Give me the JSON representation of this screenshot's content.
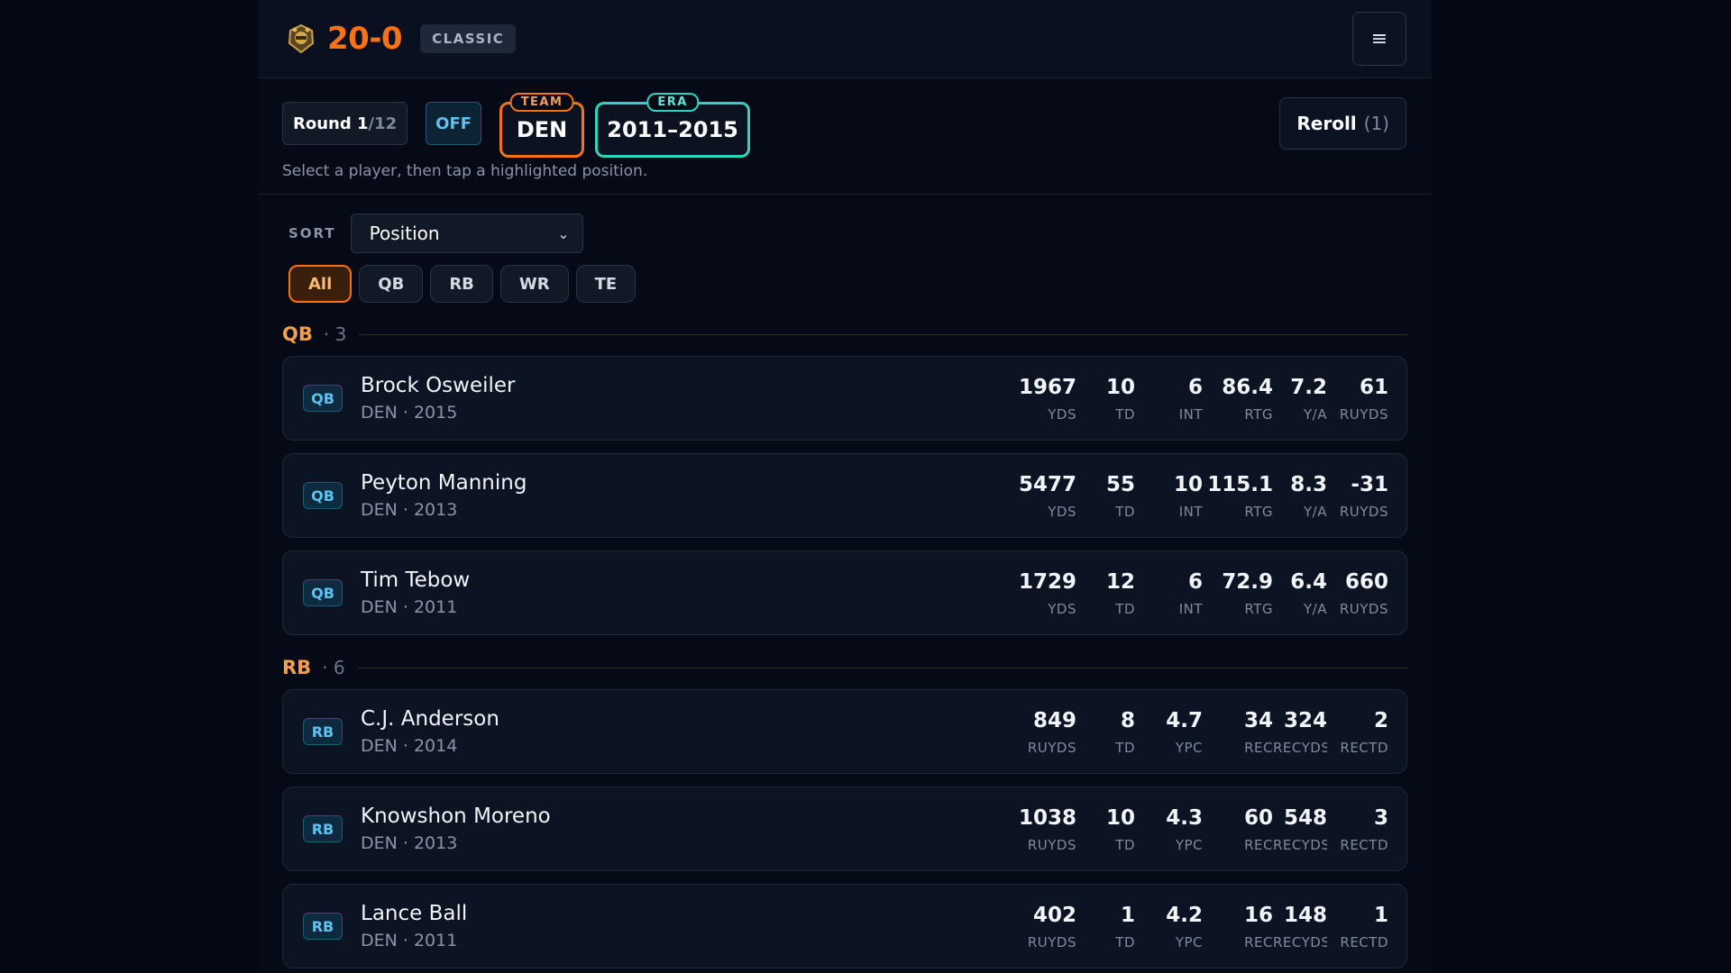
{
  "header": {
    "score": "20-0",
    "mode": "CLASSIC",
    "logo_icon": "trophy-icon",
    "menu_icon": "hamburger-icon"
  },
  "round": {
    "label": "Round 1",
    "total": "/12",
    "side": "OFF",
    "team_label": "TEAM",
    "team": "DEN",
    "era_label": "ERA",
    "era": "2011–2015",
    "reroll_label": "Reroll",
    "reroll_count": "(1)",
    "hint": "Select a player, then tap a highlighted position."
  },
  "controls": {
    "sort_label": "SORT",
    "sort_value": "Position",
    "filters": [
      "All",
      "QB",
      "RB",
      "WR",
      "TE"
    ],
    "active_filter": "All"
  },
  "sections": [
    {
      "pos": "QB",
      "count": "· 3",
      "players": [
        {
          "badge": "QB",
          "name": "Brock Osweiler",
          "sub": "DEN · 2015",
          "stats": [
            [
              "1967",
              "YDS"
            ],
            [
              "10",
              "TD"
            ],
            [
              "6",
              "INT"
            ],
            [
              "86.4",
              "RTG"
            ],
            [
              "7.2",
              "Y/A"
            ],
            [
              "61",
              "RUYDS"
            ]
          ]
        },
        {
          "badge": "QB",
          "name": "Peyton Manning",
          "sub": "DEN · 2013",
          "stats": [
            [
              "5477",
              "YDS"
            ],
            [
              "55",
              "TD"
            ],
            [
              "10",
              "INT"
            ],
            [
              "115.1",
              "RTG"
            ],
            [
              "8.3",
              "Y/A"
            ],
            [
              "-31",
              "RUYDS"
            ]
          ]
        },
        {
          "badge": "QB",
          "name": "Tim Tebow",
          "sub": "DEN · 2011",
          "stats": [
            [
              "1729",
              "YDS"
            ],
            [
              "12",
              "TD"
            ],
            [
              "6",
              "INT"
            ],
            [
              "72.9",
              "RTG"
            ],
            [
              "6.4",
              "Y/A"
            ],
            [
              "660",
              "RUYDS"
            ]
          ]
        }
      ]
    },
    {
      "pos": "RB",
      "count": "· 6",
      "players": [
        {
          "badge": "RB",
          "name": "C.J. Anderson",
          "sub": "DEN · 2014",
          "stats": [
            [
              "849",
              "RUYDS"
            ],
            [
              "8",
              "TD"
            ],
            [
              "4.7",
              "YPC"
            ],
            [
              "34",
              "REC"
            ],
            [
              "324",
              "RECYDS"
            ],
            [
              "2",
              "RECTD"
            ]
          ]
        },
        {
          "badge": "RB",
          "name": "Knowshon Moreno",
          "sub": "DEN · 2013",
          "stats": [
            [
              "1038",
              "RUYDS"
            ],
            [
              "10",
              "TD"
            ],
            [
              "4.3",
              "YPC"
            ],
            [
              "60",
              "REC"
            ],
            [
              "548",
              "RECYDS"
            ],
            [
              "3",
              "RECTD"
            ]
          ]
        },
        {
          "badge": "RB",
          "name": "Lance Ball",
          "sub": "DEN · 2011",
          "stats": [
            [
              "402",
              "RUYDS"
            ],
            [
              "1",
              "TD"
            ],
            [
              "4.2",
              "YPC"
            ],
            [
              "16",
              "REC"
            ],
            [
              "148",
              "RECYDS"
            ],
            [
              "1",
              "RECTD"
            ]
          ]
        }
      ]
    }
  ]
}
